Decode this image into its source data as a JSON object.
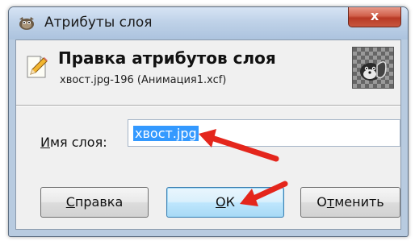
{
  "window": {
    "title": "Атрибуты слоя",
    "close_label": "x"
  },
  "header": {
    "title": "Правка атрибутов слоя",
    "subtitle": "хвост.jpg-196 (Анимация1.xcf)"
  },
  "form": {
    "name_label_access": "И",
    "name_label_rest": "мя слоя:",
    "name_value": "хвост.jpg"
  },
  "buttons": {
    "help_access": "С",
    "help_rest": "правка",
    "ok_access": "О",
    "ok_rest": "К",
    "cancel_pre": "О",
    "cancel_access": "т",
    "cancel_rest": "менить"
  },
  "colors": {
    "annotation_arrow": "#e4261c",
    "selection": "#3399ff"
  },
  "icons": [
    "gimp-icon",
    "pencil-edit-icon",
    "layer-thumbnail",
    "close-icon"
  ]
}
